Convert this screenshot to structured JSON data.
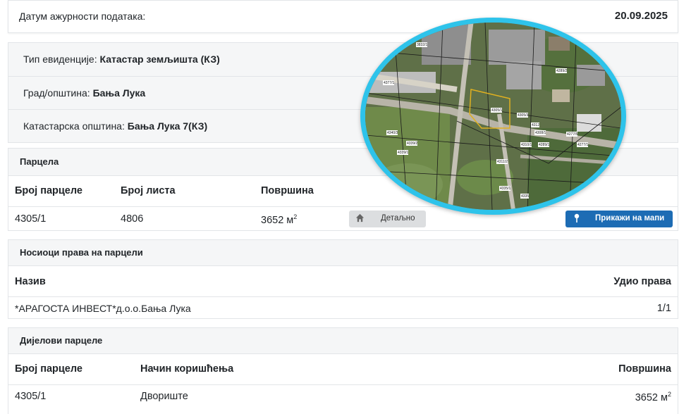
{
  "date_row": {
    "label": "Датум ажурности података:",
    "value": "20.09.2025"
  },
  "info": {
    "type_label": "Тип евиденције:",
    "type_value": "Катастар земљишта (КЗ)",
    "city_label": "Град/општина:",
    "city_value": "Бања Лука",
    "municipality_label": "Катастарска општина:",
    "municipality_value": "Бања Лука 7(КЗ)"
  },
  "parcel": {
    "title": "Парцела",
    "headers": {
      "number": "Број парцеле",
      "sheet": "Број листа",
      "area": "Површина"
    },
    "row": {
      "number": "4305/1",
      "sheet": "4806",
      "area": "3652 м",
      "area_unit_exp": "2"
    },
    "detail_button": "Детаљно",
    "map_button": "Прикажи на мапи"
  },
  "owners": {
    "title": "Носиоци права на парцели",
    "headers": {
      "name": "Назив",
      "share": "Удио права"
    },
    "row": {
      "name": "*АРАГОСТА ИНВЕСТ*д.о.о.Бања Лука",
      "share": "1/1"
    }
  },
  "parts": {
    "title": "Дијелови парцеле",
    "headers": {
      "number": "Број парцеле",
      "usage": "Начин коришћења",
      "area": "Површина"
    },
    "row": {
      "number": "4305/1",
      "usage": "Двориште",
      "area": "3652 м",
      "area_unit_exp": "2"
    }
  },
  "map": {
    "parcel_labels": [
      "3832/1",
      "4377/1",
      "4305/1",
      "4340/3",
      "4339/2",
      "4339/1",
      "4305/3",
      "4308/1",
      "4289/1",
      "4289/2",
      "4277/1",
      "4277/5",
      "4310/1",
      "4311/2",
      "4335/1",
      "4335",
      "4312"
    ],
    "icons": [
      "home-icon",
      "map-pin-icon"
    ],
    "colors": {
      "accent": "#1d6cb4",
      "ring": "#2ec3ea",
      "parcel_outline": "#e0b020"
    }
  }
}
